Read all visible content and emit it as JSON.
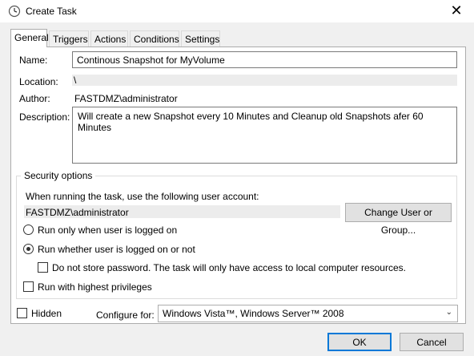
{
  "window": {
    "title": "Create Task",
    "icon": "task-scheduler-clock-icon",
    "close_glyph": "✕"
  },
  "tabs": [
    {
      "label": "General",
      "active": true
    },
    {
      "label": "Triggers",
      "active": false
    },
    {
      "label": "Actions",
      "active": false
    },
    {
      "label": "Conditions",
      "active": false
    },
    {
      "label": "Settings",
      "active": false
    }
  ],
  "general": {
    "name_label": "Name:",
    "name_value": "Continous Snapshot for MyVolume",
    "location_label": "Location:",
    "location_value": "\\",
    "author_label": "Author:",
    "author_value": "FASTDMZ\\administrator",
    "description_label": "Description:",
    "description_value": "Will create a new Snapshot every 10 Minutes and Cleanup old Snapshots afer 60 Minutes"
  },
  "security": {
    "group_label": "Security options",
    "account_prompt": "When running the task, use the following user account:",
    "account_value": "FASTDMZ\\administrator",
    "change_button": "Change User or Group...",
    "radio_logged_on": {
      "label": "Run only when user is logged on",
      "selected": false
    },
    "radio_whether": {
      "label": "Run whether user is logged on or not",
      "selected": true
    },
    "no_store_password": {
      "label": "Do not store password.  The task will only have access to local computer resources.",
      "checked": false
    },
    "highest_privileges": {
      "label": "Run with highest privileges",
      "checked": false
    }
  },
  "footer": {
    "hidden_label": "Hidden",
    "hidden_checked": false,
    "configure_label": "Configure for:",
    "configure_value": "Windows Vista™, Windows Server™ 2008"
  },
  "buttons": {
    "ok": "OK",
    "cancel": "Cancel"
  },
  "colors": {
    "accent": "#0078d7",
    "dialog_bg": "#f0f0f0",
    "panel_bg": "#ffffff"
  }
}
